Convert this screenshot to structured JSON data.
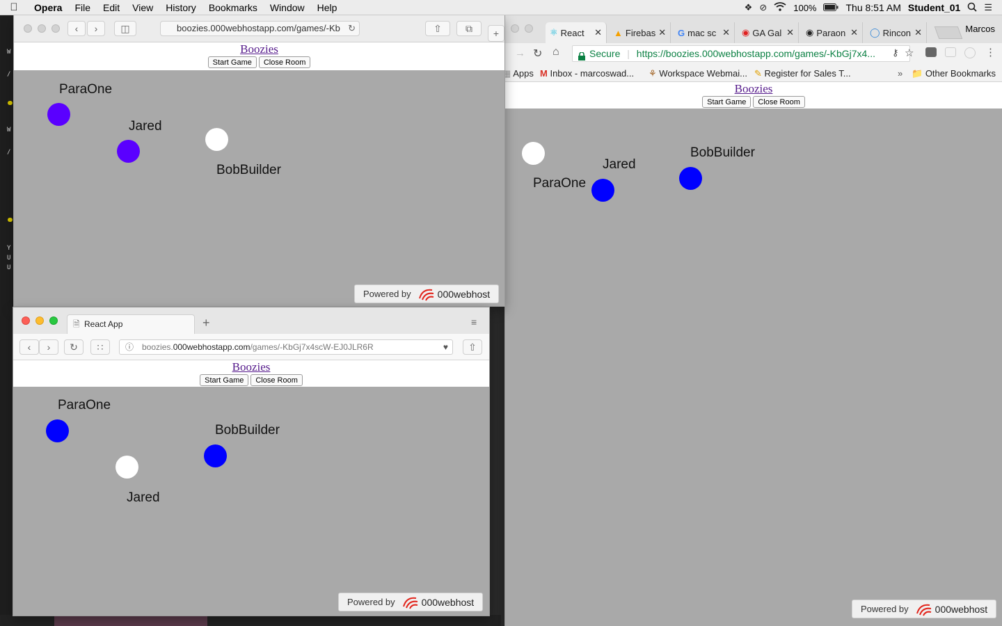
{
  "menubar": {
    "app": "Opera",
    "items": [
      "File",
      "Edit",
      "View",
      "History",
      "Bookmarks",
      "Window",
      "Help"
    ],
    "battery": "100%",
    "clock": "Thu 8:51 AM",
    "user": "Student_01"
  },
  "site": {
    "title": "Boozies",
    "start_label": "Start Game",
    "close_label": "Close Room",
    "powered_label": "Powered by",
    "brand": "000webhost"
  },
  "opera": {
    "url": "boozies.000webhostapp.com/games/-Kb",
    "players": [
      {
        "name": "ParaOne",
        "color": "#5a00ff"
      },
      {
        "name": "Jared",
        "color": "#5a00ff"
      },
      {
        "name": "BobBuilder",
        "color": "#ffffff"
      }
    ]
  },
  "chrome": {
    "tabs": [
      "React",
      "Firebas",
      "mac sc",
      "GA Gal",
      "Paraon",
      "Rincon"
    ],
    "profile": "Marcos",
    "secure_label": "Secure",
    "url": "https://boozies.000webhostapp.com/games/-KbGj7x4...",
    "bookmarks": [
      "Apps",
      "Inbox - marcoswad...",
      "Workspace Webmai...",
      "Register for Sales T...",
      "Other Bookmarks"
    ],
    "players": [
      {
        "name": "ParaOne",
        "color": "#ffffff"
      },
      {
        "name": "Jared",
        "color": "#0000ff"
      },
      {
        "name": "BobBuilder",
        "color": "#0000ff"
      }
    ]
  },
  "firefox": {
    "tab_title": "React App",
    "url_prefix": "boozies.",
    "url_host": "000webhostapp.com",
    "url_path": "/games/-KbGj7x4scW-EJ0JLR6R",
    "players": [
      {
        "name": "ParaOne",
        "color": "#0000ff"
      },
      {
        "name": "Jared",
        "color": "#ffffff"
      },
      {
        "name": "BobBuilder",
        "color": "#0000ff"
      }
    ]
  }
}
